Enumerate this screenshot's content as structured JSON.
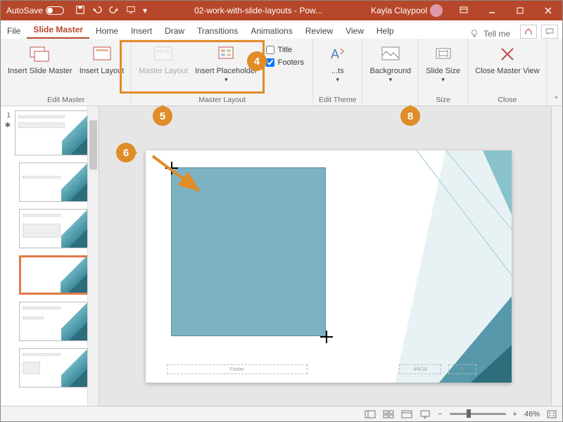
{
  "titlebar": {
    "autosave": "AutoSave",
    "filename": "02-work-with-slide-layouts - Pow...",
    "user": "Kayla Claypool"
  },
  "tabs": [
    "File",
    "Slide Master",
    "Home",
    "Insert",
    "Draw",
    "Transitions",
    "Animations",
    "Review",
    "View",
    "Help"
  ],
  "active_tab": 1,
  "tell_me": "Tell me",
  "ribbon": {
    "edit_master": {
      "insert_slide_master": "Insert Slide Master",
      "insert_layout": "Insert Layout",
      "label": "Edit Master"
    },
    "master_layout": {
      "master_layout": "Master Layout",
      "insert_placeholder": "Insert Placeholder",
      "chk_title": "Title",
      "chk_footers": "Footers",
      "label": "Master Layout"
    },
    "edit_theme": {
      "fonts": "...ts",
      "label": "Edit Theme"
    },
    "background": {
      "btn": "Background",
      "label": ""
    },
    "size": {
      "btn": "Slide Size",
      "label": "Size"
    },
    "close": {
      "btn": "Close Master View",
      "label": "Close"
    }
  },
  "callouts": {
    "c4": "4",
    "c5": "5",
    "c6": "6",
    "c8": "8"
  },
  "slide": {
    "footer": "Footer",
    "date": "4/4/18"
  },
  "thumbs": {
    "num": "1"
  },
  "status": {
    "zoom": "46%"
  }
}
